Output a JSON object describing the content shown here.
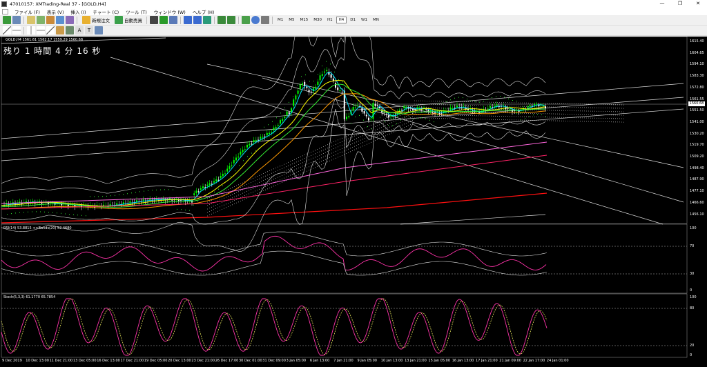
{
  "window": {
    "title": "47010157: XMTrading-Real 37 - [GOLD,H4]",
    "controls": {
      "minimize": "—",
      "restore": "❐",
      "close": "✕"
    }
  },
  "menu": [
    "ファイル (F)",
    "表示 (V)",
    "挿入 (I)",
    "チャート (C)",
    "ツール (T)",
    "ウィンドウ (W)",
    "ヘルプ (H)"
  ],
  "toolbar": {
    "new_order": "新規注文",
    "auto_trading": "自動売買",
    "timeframes": [
      "M1",
      "M5",
      "M15",
      "M30",
      "H1",
      "H4",
      "D1",
      "W1",
      "MN"
    ],
    "active_timeframe": "H4"
  },
  "chart": {
    "symbol_line": "GOLD,H4  1561.61 1562.17 1559.29 1560.68",
    "countdown": "残り 1 時間 4 分 16 秒",
    "current_price": "1560.68",
    "price_labels": [
      "1615.40",
      "1604.65",
      "1594.10",
      "1583.30",
      "1572.80",
      "1561.55",
      "1551.50",
      "1541.00",
      "1530.20",
      "1519.70",
      "1509.20",
      "1498.40",
      "1487.90",
      "1477.10",
      "1466.60",
      "1456.10"
    ],
    "rsi_label": "RSI(14) 53.8815  <>Bands(20) 52.4680",
    "rsi_levels": [
      "100",
      "70",
      "30",
      "0"
    ],
    "stoch_label": "Stoch(5,3,3) 61.1770 65.7854",
    "stoch_levels": [
      "100",
      "80",
      "20",
      "0"
    ],
    "time_labels": [
      "9 Dec 2019",
      "10 Dec 13:00",
      "11 Dec 21:00",
      "13 Dec 05:00",
      "16 Dec 13:00",
      "17 Dec 21:00",
      "19 Dec 05:00",
      "20 Dec 13:00",
      "23 Dec 21:00",
      "26 Dec 17:00",
      "30 Dec 01:00",
      "31 Dec 09:00",
      "3 Jan 05:00",
      "6 Jan 13:00",
      "7 Jan 21:00",
      "9 Jan 05:00",
      "10 Jan 13:00",
      "13 Jan 21:00",
      "15 Jan 05:00",
      "16 Jan 13:00",
      "17 Jan 21:00",
      "21 Jan 09:00",
      "22 Jan 17:00",
      "24 Jan 01:00"
    ]
  },
  "colors": {
    "bull": "#00ff00",
    "bear": "#ffffff",
    "ma_cyan": "#00e5ff",
    "ma_yellow": "#ffff00",
    "ma_orange": "#ff9900",
    "ma_green": "#33ee33",
    "ma_magenta": "#ff66dd",
    "ma_pink": "#ff2266",
    "ma_red": "#ff1010",
    "rsi_magenta": "#ff33aa",
    "stoch_dashed": "#ffff66"
  }
}
